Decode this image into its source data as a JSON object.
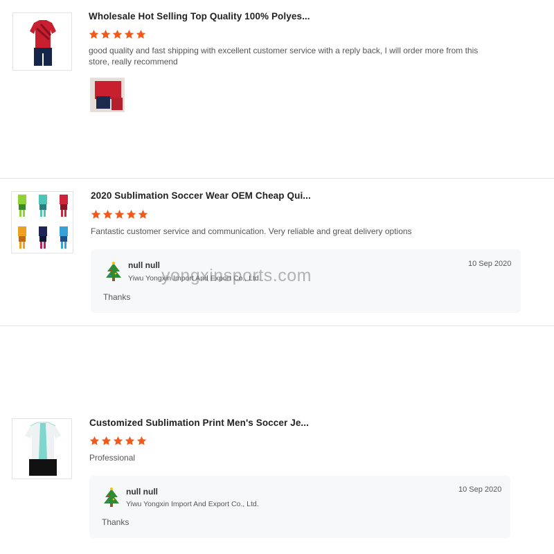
{
  "colors": {
    "star": "#f05a1a",
    "divider": "#e5e5e5",
    "reply_bg": "#f7f8fa"
  },
  "reviews": [
    {
      "title": "Wholesale Hot Selling Top Quality 100% Polyes...",
      "rating": 5,
      "comment": "good quality and fast shipping with excellent customer service with a reply back, I will order more from this store, really recommend",
      "has_photo": true
    },
    {
      "title": "2020 Sublimation Soccer Wear OEM Cheap Qui...",
      "rating": 5,
      "comment": "Fantastic customer service and communication. Very reliable and great delivery options",
      "reply": {
        "name": "null null",
        "company": "Yiwu Yongxin Import And Export Co., Ltd.",
        "date": "10 Sep 2020",
        "text": "Thanks"
      }
    },
    {
      "title": "Customized Sublimation Print Men's Soccer Je...",
      "rating": 5,
      "comment": "Professional",
      "reply": {
        "name": "null null",
        "company": "Yiwu Yongxin Import And Export Co., Ltd.",
        "date": "10 Sep 2020",
        "text": "Thanks"
      }
    }
  ],
  "watermark": "yongxinsports.com"
}
